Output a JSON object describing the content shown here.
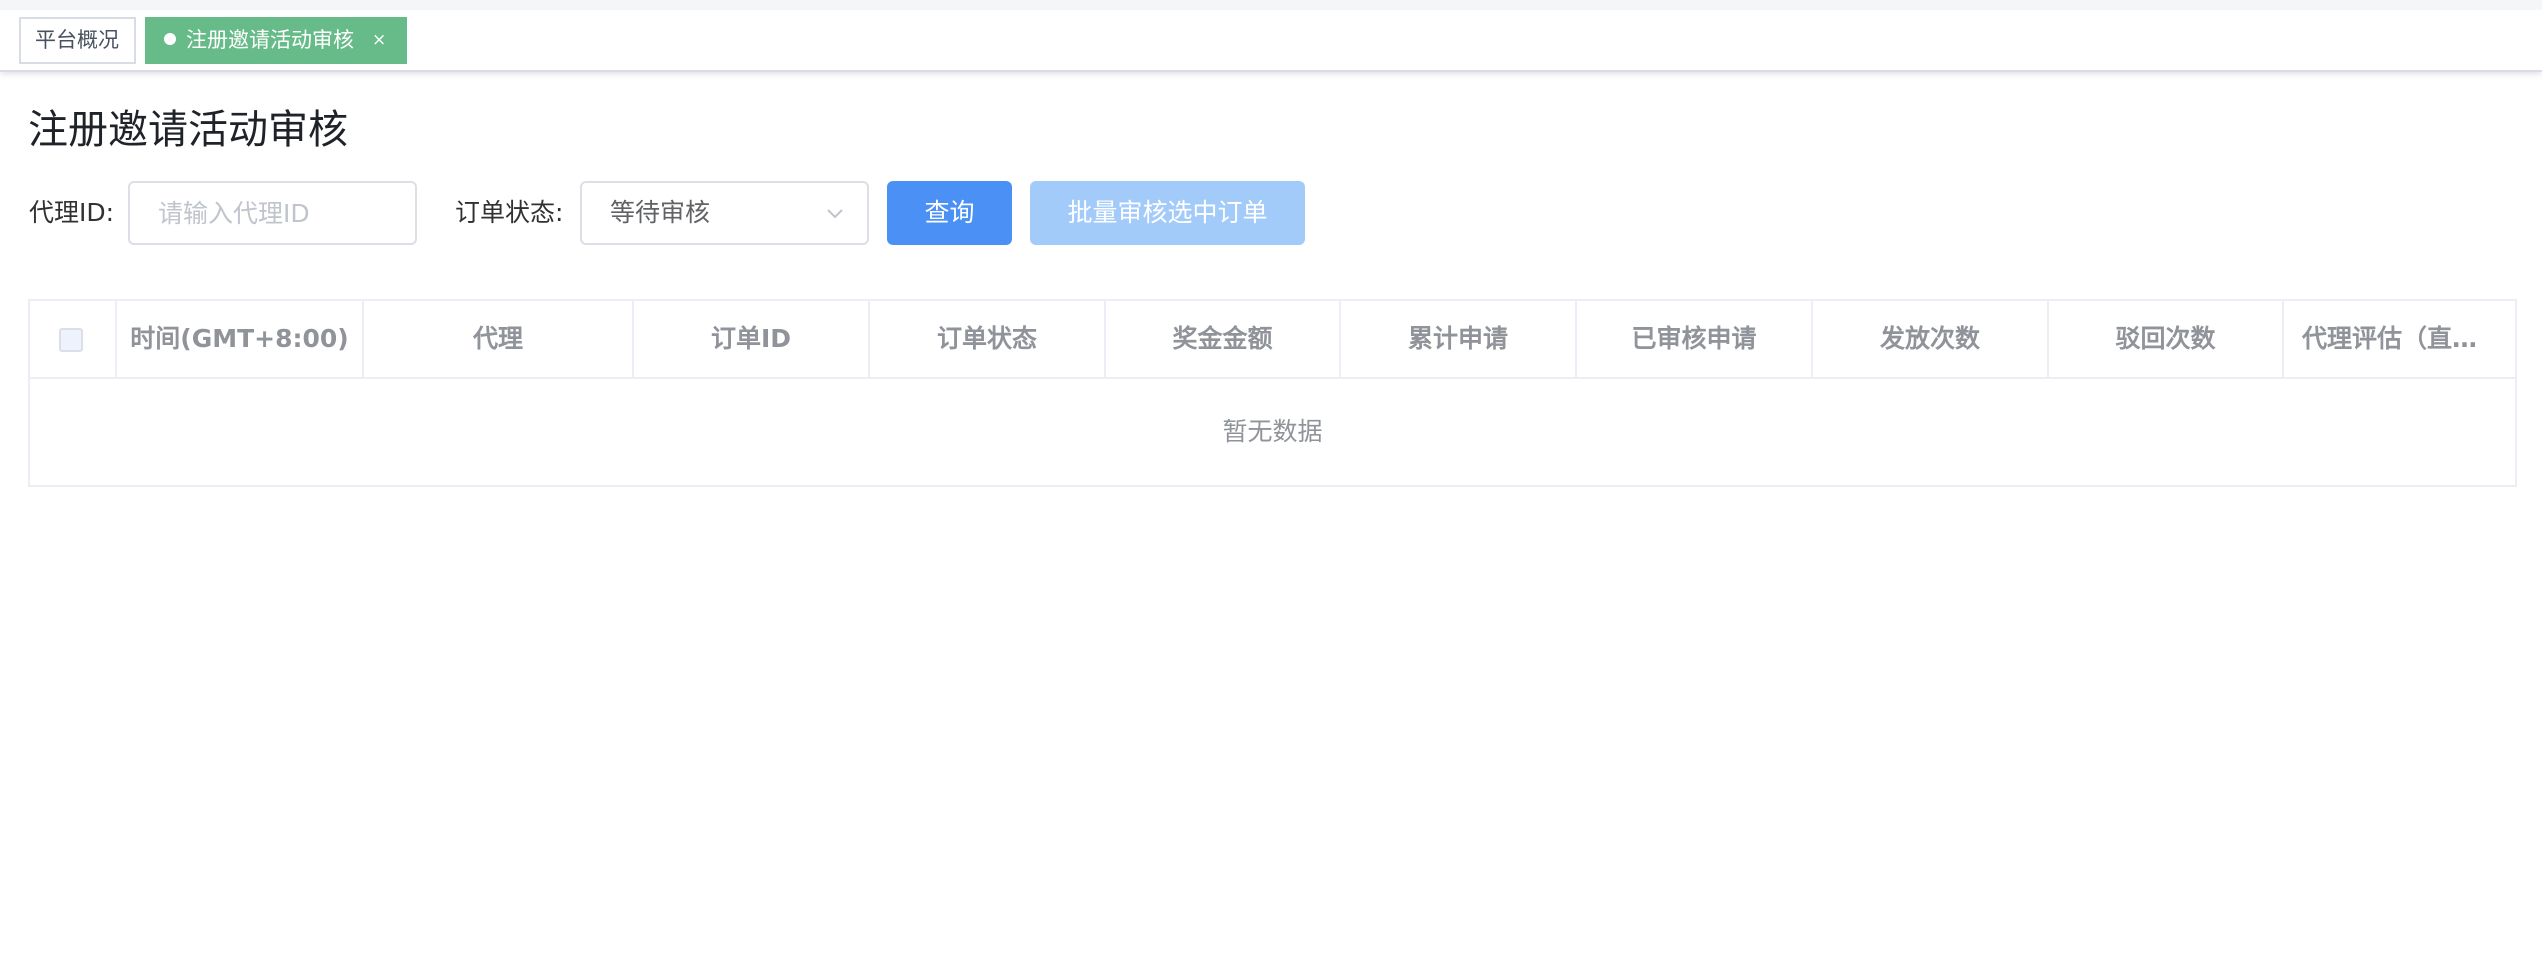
{
  "tags": {
    "items": [
      {
        "label": "平台概况"
      },
      {
        "label": "注册邀请活动审核",
        "close": "×"
      }
    ]
  },
  "page": {
    "title": "注册邀请活动审核"
  },
  "filters": {
    "agent_label": "代理ID:",
    "agent_placeholder": "请输入代理ID",
    "status_label": "订单状态:",
    "status_value": "等待审核"
  },
  "buttons": {
    "query": "查询",
    "batch_review": "批量审核选中订单"
  },
  "table": {
    "columns": [
      "时间(GMT+8:00)",
      "代理",
      "订单ID",
      "订单状态",
      "奖金金额",
      "累计申请",
      "已审核申请",
      "发放次数",
      "驳回次数",
      "代理评估（直…"
    ],
    "rows": [],
    "empty_text": "暂无数据"
  },
  "colors": {
    "active_tag": "#67bb88",
    "primary": "#4a90f5",
    "primary_disabled": "#a3cbf9"
  },
  "icons": {
    "tag_dot": "dot-icon",
    "tag_close": "close-icon",
    "select_arrow": "chevron-down-icon"
  }
}
